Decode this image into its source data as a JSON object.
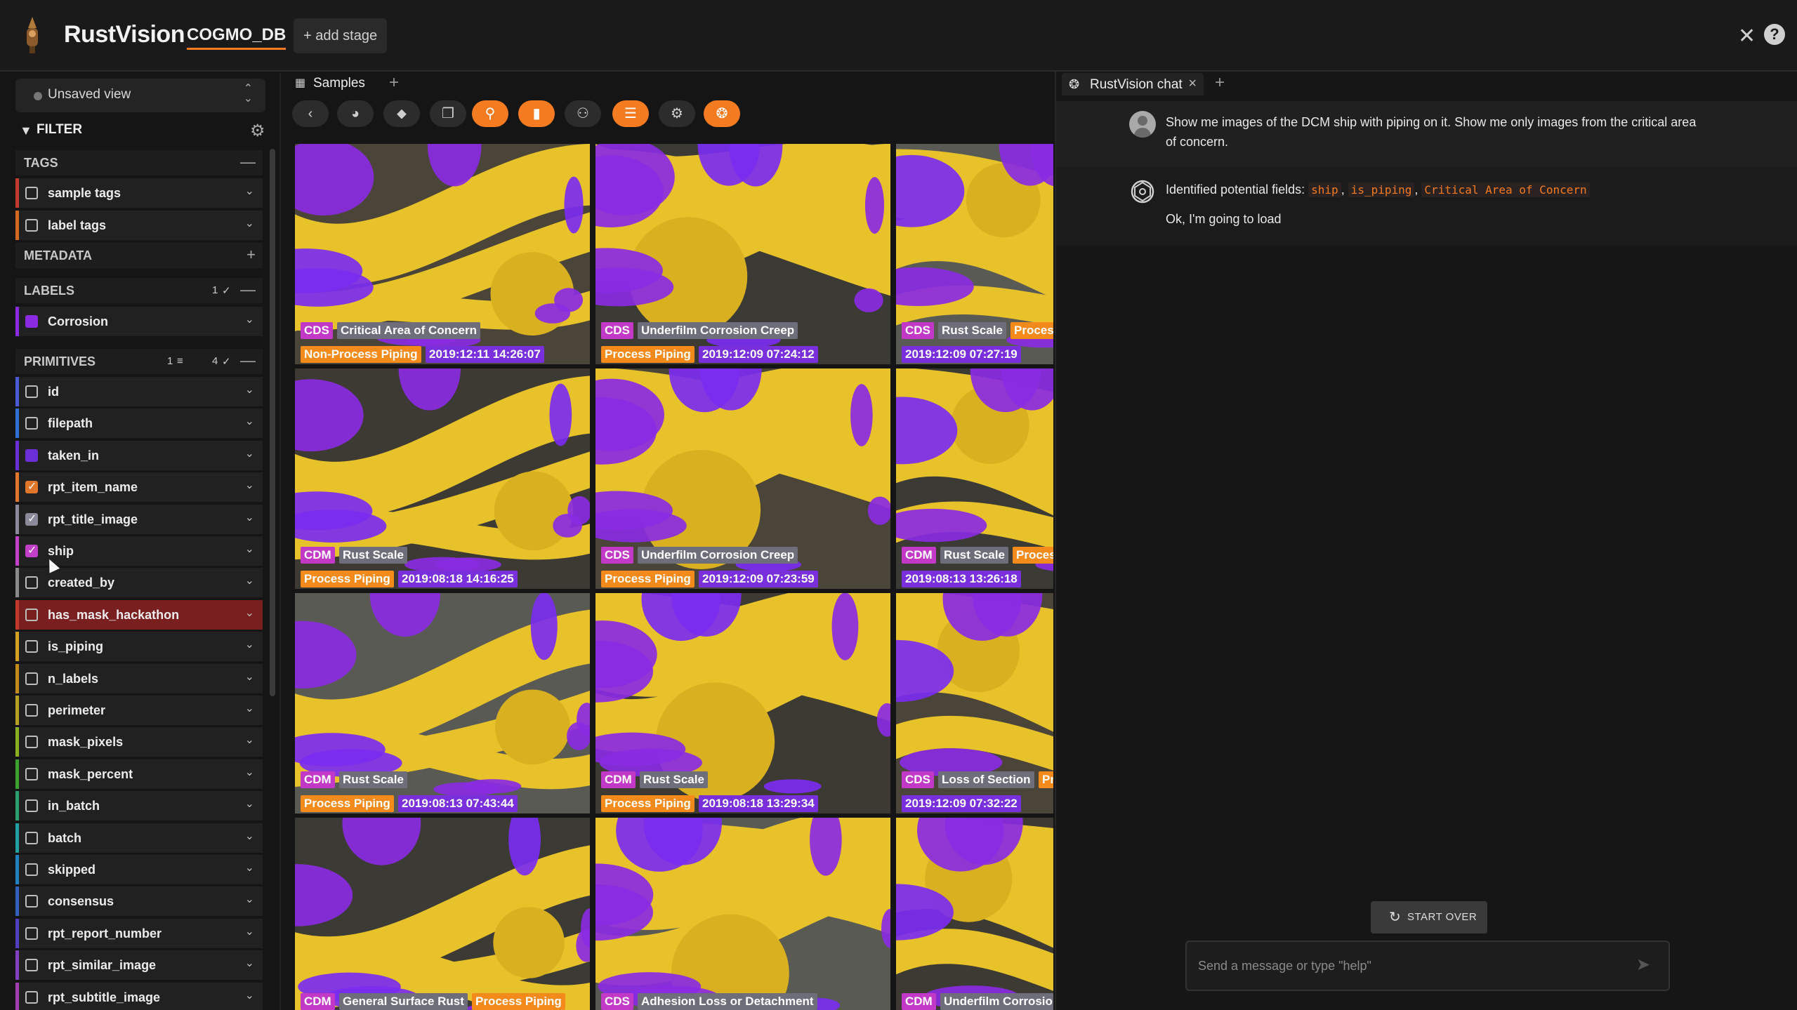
{
  "app": {
    "brand": "RustVision",
    "dataset": "COGMO_DB",
    "add_stage": "+ add stage",
    "close_icon": "close-icon",
    "help": "?"
  },
  "sidebar": {
    "view": "Unsaved view",
    "filter_title": "FILTER",
    "sections": {
      "tags": "TAGS",
      "metadata": "METADATA",
      "labels": "LABELS",
      "labels_count": "1",
      "primitives": "PRIMITIVES",
      "primitives_filter_count": "1",
      "primitives_check_count": "4"
    },
    "tag_rows": [
      {
        "label": "sample tags",
        "color": "#c23a2e"
      },
      {
        "label": "label tags",
        "color": "#d2691e"
      }
    ],
    "label_rows": [
      {
        "label": "Corrosion",
        "color": "#8a2be2"
      }
    ],
    "primitive_rows": [
      {
        "label": "id",
        "color": "#4a5bd6",
        "checked": false
      },
      {
        "label": "filepath",
        "color": "#2f6fd6",
        "checked": false
      },
      {
        "label": "taken_in",
        "color": "#6a2fd6",
        "checked": false
      },
      {
        "label": "rpt_item_name",
        "color": "#e0762a",
        "checked": true
      },
      {
        "label": "rpt_title_image",
        "color": "#8a8a9a",
        "checked": true
      },
      {
        "label": "ship",
        "color": "#c23fc7",
        "checked": true
      },
      {
        "label": "created_by",
        "color": "#8a8a8a",
        "checked": false
      },
      {
        "label": "has_mask_hackathon",
        "color": "#c0392b",
        "checked": false
      },
      {
        "label": "is_piping",
        "color": "#d4a020",
        "checked": false
      },
      {
        "label": "n_labels",
        "color": "#c28a1a",
        "checked": false
      },
      {
        "label": "perimeter",
        "color": "#b5a020",
        "checked": false
      },
      {
        "label": "mask_pixels",
        "color": "#8ab020",
        "checked": false
      },
      {
        "label": "mask_percent",
        "color": "#3aa030",
        "checked": false
      },
      {
        "label": "in_batch",
        "color": "#2aa070",
        "checked": false
      },
      {
        "label": "batch",
        "color": "#20a0a0",
        "checked": false
      },
      {
        "label": "skipped",
        "color": "#2080c0",
        "checked": false
      },
      {
        "label": "consensus",
        "color": "#3060c0",
        "checked": false
      },
      {
        "label": "rpt_report_number",
        "color": "#5040c0",
        "checked": false
      },
      {
        "label": "rpt_similar_image",
        "color": "#8040c0",
        "checked": false
      },
      {
        "label": "rpt_subtitle_image",
        "color": "#a040b0",
        "checked": false
      }
    ]
  },
  "samples": {
    "tab_label": "Samples",
    "toolbar_icons": [
      "chevron-left-icon",
      "palette-icon",
      "tag-icon",
      "patches-icon",
      "search-icon",
      "bookmark-icon",
      "similarity-icon",
      "list-icon",
      "settings-icon",
      "openai-icon"
    ],
    "tiles": [
      {
        "tags": [
          {
            "t": "CDS",
            "c": "pink"
          },
          {
            "t": "Critical Area of Concern",
            "c": "gray"
          },
          {
            "t": "Non-Process Piping",
            "c": "orange"
          },
          {
            "t": "2019:12:11 14:26:07",
            "c": "date"
          }
        ]
      },
      {
        "tags": [
          {
            "t": "CDS",
            "c": "pink"
          },
          {
            "t": "Underfilm Corrosion Creep",
            "c": "gray"
          },
          {
            "t": "Process Piping",
            "c": "orange"
          },
          {
            "t": "2019:12:09 07:24:12",
            "c": "date"
          }
        ]
      },
      {
        "tags": [
          {
            "t": "CDS",
            "c": "pink"
          },
          {
            "t": "Rust Scale",
            "c": "gray"
          },
          {
            "t": "Process",
            "c": "orange"
          },
          {
            "t": "2019:12:09 07:27:19",
            "c": "date"
          }
        ]
      },
      {
        "tags": [
          {
            "t": "CDM",
            "c": "pink"
          },
          {
            "t": "Rust Scale",
            "c": "gray"
          },
          {
            "t": "Process Piping",
            "c": "orange"
          },
          {
            "t": "2019:08:18 14:16:25",
            "c": "date"
          }
        ]
      },
      {
        "tags": [
          {
            "t": "CDS",
            "c": "pink"
          },
          {
            "t": "Underfilm Corrosion Creep",
            "c": "gray"
          },
          {
            "t": "Process Piping",
            "c": "orange"
          },
          {
            "t": "2019:12:09 07:23:59",
            "c": "date"
          }
        ]
      },
      {
        "tags": [
          {
            "t": "CDM",
            "c": "pink"
          },
          {
            "t": "Rust Scale",
            "c": "gray"
          },
          {
            "t": "Process",
            "c": "orange"
          },
          {
            "t": "2019:08:13 13:26:18",
            "c": "date"
          }
        ]
      },
      {
        "tags": [
          {
            "t": "CDM",
            "c": "pink"
          },
          {
            "t": "Rust Scale",
            "c": "gray"
          },
          {
            "t": "Process Piping",
            "c": "orange"
          },
          {
            "t": "2019:08:13 07:43:44",
            "c": "date"
          }
        ]
      },
      {
        "tags": [
          {
            "t": "CDM",
            "c": "pink"
          },
          {
            "t": "Rust Scale",
            "c": "gray"
          },
          {
            "t": "Process Piping",
            "c": "orange"
          },
          {
            "t": "2019:08:18 13:29:34",
            "c": "date"
          }
        ]
      },
      {
        "tags": [
          {
            "t": "CDS",
            "c": "pink"
          },
          {
            "t": "Loss of Section",
            "c": "gray"
          },
          {
            "t": "Pro",
            "c": "orange"
          },
          {
            "t": "2019:12:09 07:32:22",
            "c": "date"
          }
        ]
      },
      {
        "tags": [
          {
            "t": "CDM",
            "c": "pink"
          },
          {
            "t": "General Surface Rust",
            "c": "gray"
          },
          {
            "t": "Process Piping",
            "c": "orange"
          }
        ]
      },
      {
        "tags": [
          {
            "t": "CDS",
            "c": "pink"
          },
          {
            "t": "Adhesion Loss or Detachment",
            "c": "gray"
          }
        ]
      },
      {
        "tags": [
          {
            "t": "CDM",
            "c": "pink"
          },
          {
            "t": "Underfilm Corrosio",
            "c": "gray"
          }
        ]
      }
    ]
  },
  "chat": {
    "tab_label": "RustVision chat",
    "user_message": "Show me images of the DCM ship with piping on it. Show me only images from the critical area of concern.",
    "bot_prefix": "Identified potential fields:",
    "bot_fields": [
      "ship",
      "is_piping",
      "Critical Area of Concern"
    ],
    "bot_line2": "Ok, I'm going to load",
    "start_over": "START OVER",
    "input_placeholder": "Send a message or type \"help\""
  },
  "colors": {
    "accent": "#f47b20",
    "mask_purple": "#8a2be2",
    "pipe_yellow": "#e8c22a"
  }
}
